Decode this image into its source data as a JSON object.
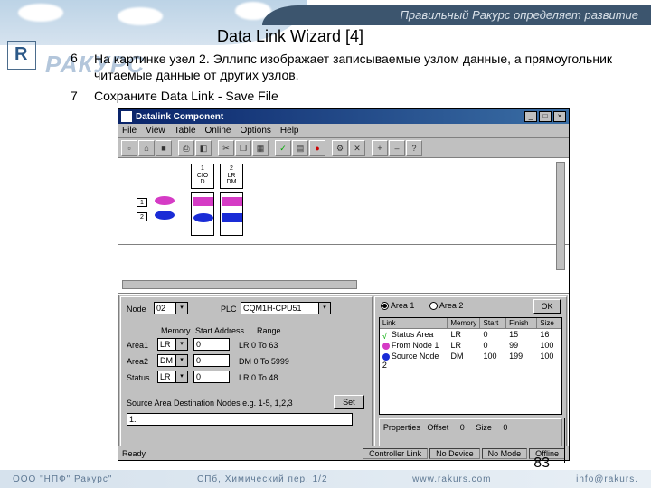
{
  "banner": {
    "slogan": "Правильный Ракурс определяет развитие",
    "watermark": "РАКУРС"
  },
  "title": "Data Link Wizard [4]",
  "items": {
    "n6": "6",
    "p6": "На картинке узел 2. Эллипс изображает записываемые узлом данные, а прямоугольник читаемые данные от других узлов.",
    "n7": "7",
    "p7": "Сохраните Data Link - Save File"
  },
  "page_number": "83",
  "app": {
    "title": "Datalink Component",
    "menu": [
      "File",
      "View",
      "Table",
      "Online",
      "Options",
      "Help"
    ],
    "toolbar_icons": [
      "new",
      "open",
      "save",
      "",
      "print",
      "preview",
      "",
      "cut",
      "copy",
      "paste",
      "",
      "check",
      "grid",
      "stop",
      "",
      "cfg",
      "link",
      "",
      "zoom-in",
      "zoom-out",
      "help"
    ],
    "nodes": [
      {
        "id": "1",
        "lines": [
          "1",
          "CIO",
          "D"
        ]
      },
      {
        "id": "2",
        "lines": [
          "2",
          "LR",
          "DM"
        ]
      }
    ],
    "row_labels": [
      "1",
      "2"
    ],
    "left_panel": {
      "node_label": "Node",
      "node_value": "02",
      "plc_label": "PLC",
      "plc_value": "CQM1H-CPU51",
      "cols": [
        "Memory",
        "Start Address",
        "Range"
      ],
      "areas": [
        {
          "name": "Area1",
          "mem": "LR",
          "addr": "0",
          "range": "LR   0   To   63"
        },
        {
          "name": "Area2",
          "mem": "DM",
          "addr": "0",
          "range": "DM   0   To   5999"
        },
        {
          "name": "Status",
          "mem": "LR",
          "addr": "0",
          "range": "LR   0   To   48"
        }
      ],
      "src_label": "Source Area  Destination Nodes  e.g. 1-5, 1,2,3",
      "src_value": "1.",
      "set_btn": "Set"
    },
    "right_panel": {
      "area1_label": "Area 1",
      "area2_label": "Area 2",
      "cols": [
        "Link",
        "Memory",
        "Start",
        "Finish",
        "Size"
      ],
      "rows": [
        {
          "link": "Status Area",
          "mem": "LR",
          "start": "0",
          "finish": "15",
          "size": "16",
          "color": "#00aa55",
          "shape": "check"
        },
        {
          "link": "From Node 1",
          "mem": "LR",
          "start": "0",
          "finish": "99",
          "size": "100",
          "color": "#d53bc5",
          "shape": "ellipse"
        },
        {
          "link": "Source Node 2",
          "mem": "DM",
          "start": "100",
          "finish": "199",
          "size": "100",
          "color": "#1a2cd6",
          "shape": "ellipse"
        }
      ],
      "props_label": "Properties",
      "offset_label": "Offset",
      "offset_val": "0",
      "size_label": "Size",
      "size_val": "0",
      "ok": "OK"
    },
    "status": {
      "ready": "Ready",
      "cells": [
        "Controller Link",
        "No Device",
        "No Mode",
        "Offline"
      ]
    }
  },
  "footer": {
    "company": "ООО \"НПФ\" Ракурс\"",
    "addr": "СПб, Химический пер. 1/2",
    "url": "www.rakurs.com",
    "email": "info@rakurs."
  }
}
